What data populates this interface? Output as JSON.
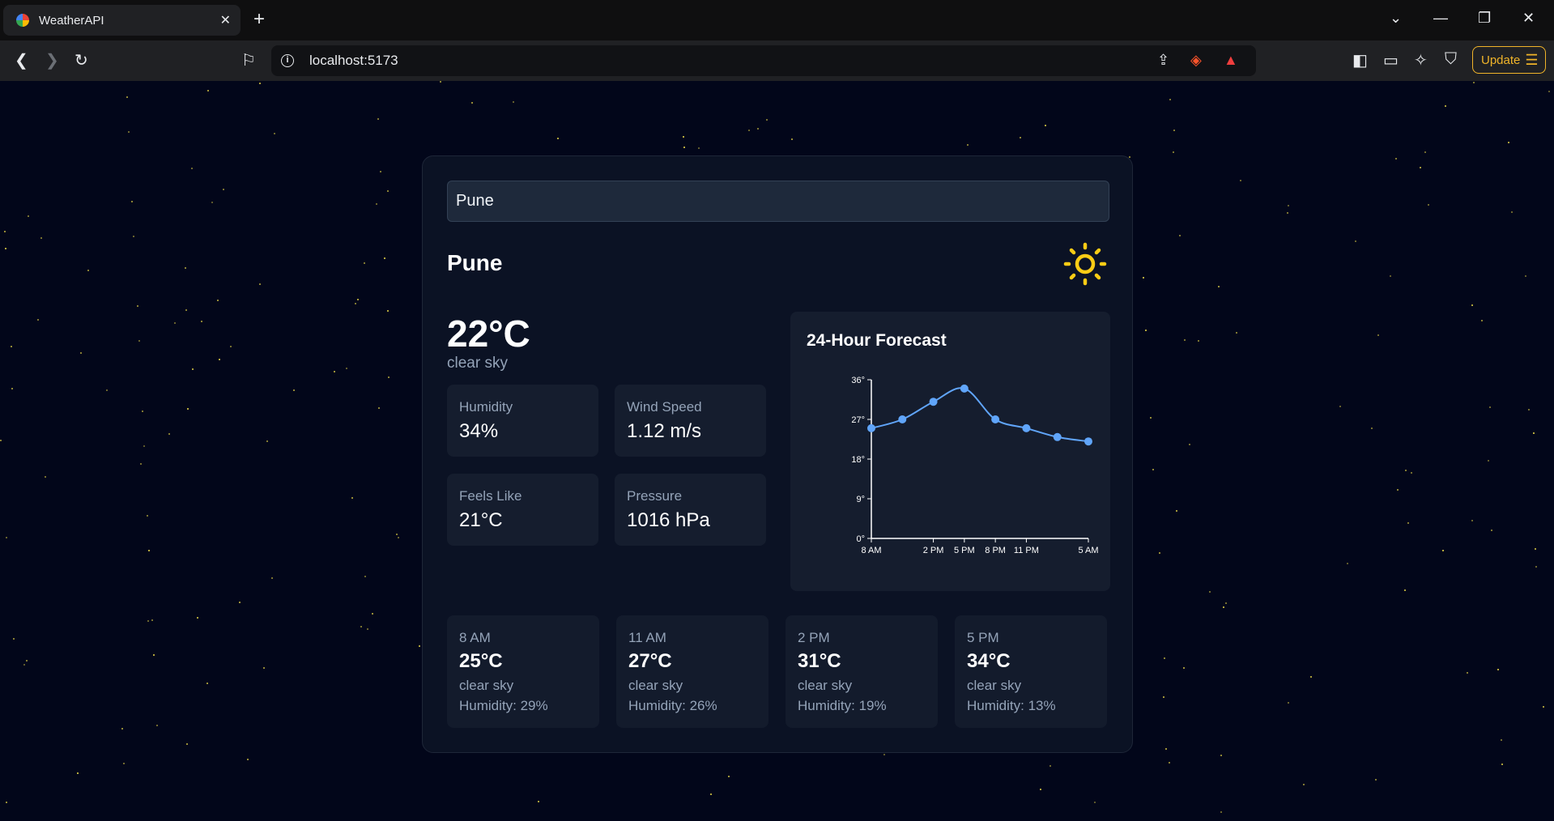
{
  "browser": {
    "tab_title": "WeatherAPI",
    "url": "localhost:5173",
    "update_label": "Update"
  },
  "weather": {
    "search_value": "Pune",
    "city": "Pune",
    "temperature": "22°C",
    "description": "clear sky",
    "stats": [
      {
        "label": "Humidity",
        "value": "34%"
      },
      {
        "label": "Wind Speed",
        "value": "1.12 m/s"
      },
      {
        "label": "Feels Like",
        "value": "21°C"
      },
      {
        "label": "Pressure",
        "value": "1016 hPa"
      }
    ],
    "forecast_title": "24-Hour Forecast",
    "hourly": [
      {
        "time": "8 AM",
        "temp": "25°C",
        "desc": "clear sky",
        "humidity": "Humidity: 29%"
      },
      {
        "time": "11 AM",
        "temp": "27°C",
        "desc": "clear sky",
        "humidity": "Humidity: 26%"
      },
      {
        "time": "2 PM",
        "temp": "31°C",
        "desc": "clear sky",
        "humidity": "Humidity: 19%"
      },
      {
        "time": "5 PM",
        "temp": "34°C",
        "desc": "clear sky",
        "humidity": "Humidity: 13%"
      }
    ]
  },
  "chart_data": {
    "type": "line",
    "x": [
      0,
      3,
      6,
      9,
      12,
      15,
      18,
      21
    ],
    "xtick_values": [
      0,
      6,
      9,
      12,
      15,
      21
    ],
    "xtick_labels": [
      "8 AM",
      "2 PM",
      "5 PM",
      "8 PM",
      "11 PM",
      "5 AM"
    ],
    "values": [
      25,
      27,
      31,
      34,
      27,
      25,
      23,
      22
    ],
    "ytick_values": [
      0,
      9,
      18,
      27,
      36
    ],
    "ytick_labels": [
      "0°",
      "9°",
      "18°",
      "27°",
      "36°"
    ],
    "ylim": [
      0,
      36
    ],
    "xlim": [
      0,
      21
    ],
    "line_color": "#60a5fa",
    "grid": false
  },
  "colors": {
    "sun": "#facc15",
    "accent": "#60a5fa",
    "update": "#f0b429"
  }
}
